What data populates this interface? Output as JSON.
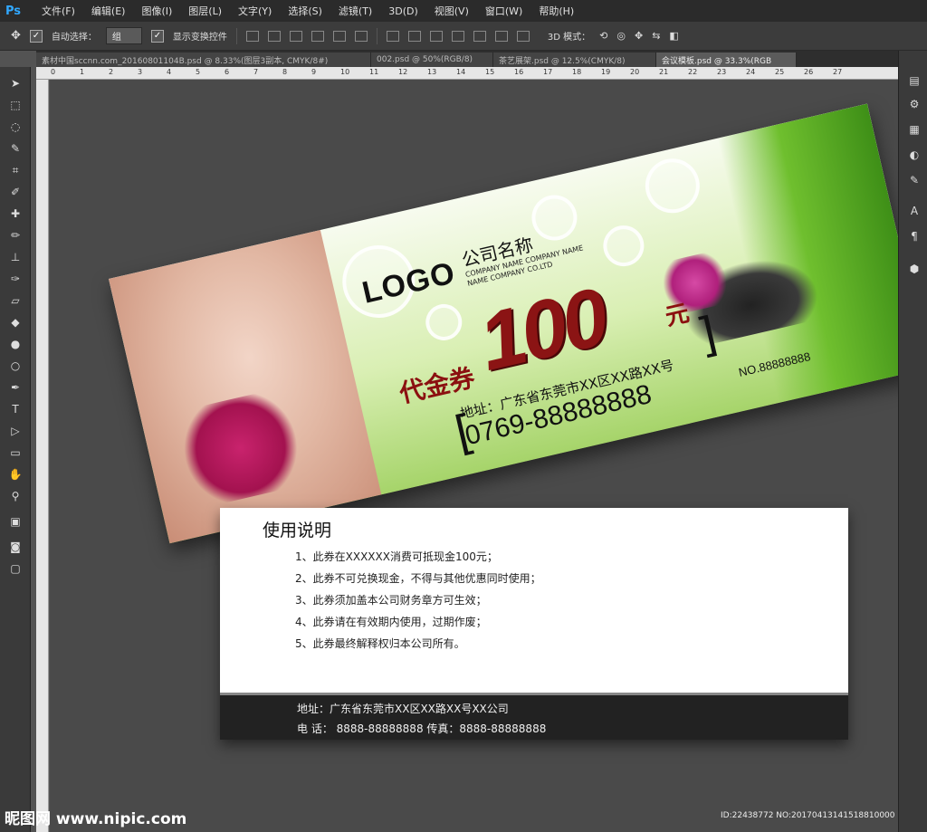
{
  "app": {
    "logo": "Ps",
    "menu": [
      "文件(F)",
      "编辑(E)",
      "图像(I)",
      "图层(L)",
      "文字(Y)",
      "选择(S)",
      "滤镜(T)",
      "3D(D)",
      "视图(V)",
      "窗口(W)",
      "帮助(H)"
    ]
  },
  "options": {
    "auto_select_label": "自动选择：",
    "auto_select_value": "组",
    "show_transform_label": "显示变换控件",
    "mode_3d_label": "3D 模式："
  },
  "tabs": [
    {
      "label": "素材中国sccnn.com_20160801104B.psd @ 8.33%(图层3副本, CMYK/8#)",
      "active": false
    },
    {
      "label": "002.psd @ 50%(RGB/8)",
      "active": false
    },
    {
      "label": "茶艺展架.psd @ 12.5%(CMYK/8)",
      "active": false
    },
    {
      "label": "会议模板.psd @ 33.3%(RGB",
      "active": true
    }
  ],
  "ruler_ticks": [
    "0",
    "1",
    "2",
    "3",
    "4",
    "5",
    "6",
    "7",
    "8",
    "9",
    "10",
    "11",
    "12",
    "13",
    "14",
    "15",
    "16",
    "17",
    "18",
    "19",
    "20",
    "21",
    "22",
    "23",
    "24",
    "25",
    "26",
    "27"
  ],
  "voucher_front": {
    "logo": "LOGO",
    "company_cn": "公司名称",
    "company_en1": "COMPANY NAME COMPANY NAME",
    "company_en2": "NAME COMPANY CO.LTD",
    "label": "代金券",
    "amount": "100",
    "unit": "元",
    "address": "地址：广东省东莞市XX区XX路XX号",
    "phone": "0769-88888888",
    "number": "NO.88888888"
  },
  "voucher_back": {
    "title": "使用说明",
    "items": [
      "1、此券在XXXXXX消费可抵现金100元；",
      "2、此券不可兑换现金，不得与其他优惠同时使用；",
      "3、此券须加盖本公司财务章方可生效；",
      "4、此券请在有效期内使用，过期作废；",
      "5、此券最终解释权归本公司所有。"
    ],
    "footer_address": "地址：广东省东莞市XX区XX路XX号XX公司",
    "footer_phone": "电 话： 8888-88888888  传真：8888-88888888"
  },
  "watermark": {
    "left": "昵图网 www.nipic.com",
    "right": "ID:22438772 NO:20170413141518810000"
  }
}
